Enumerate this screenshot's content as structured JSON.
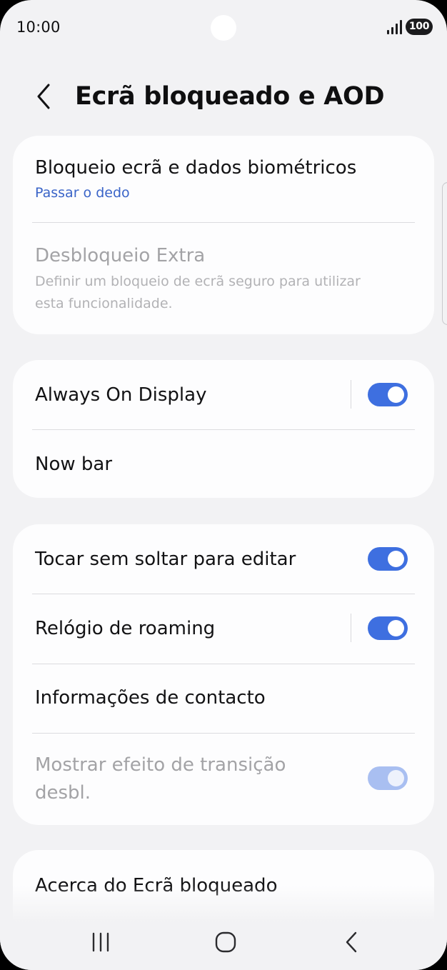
{
  "status_bar": {
    "time": "10:00",
    "battery": "100"
  },
  "header": {
    "title": "Ecrã bloqueado e AOD"
  },
  "cards": {
    "lock": {
      "items": [
        {
          "title": "Bloqueio ecrã e dados biométricos",
          "subtitle": "Passar o dedo"
        },
        {
          "title": "Desbloqueio Extra",
          "subtitle_line1": "Definir um bloqueio de ecrã seguro para utilizar",
          "subtitle_line2": "esta funcionalidade."
        }
      ]
    },
    "display": {
      "items": [
        {
          "title": "Always On Display",
          "toggle_on": true
        },
        {
          "title": "Now bar"
        }
      ]
    },
    "options": {
      "items": [
        {
          "title": "Tocar sem soltar para editar",
          "toggle_on": true
        },
        {
          "title": "Relógio de roaming",
          "toggle_on": true
        },
        {
          "title": "Informações de contacto"
        },
        {
          "title_line1": "Mostrar efeito de transição",
          "title_line2": "desbl.",
          "toggle_on": true,
          "disabled": true
        }
      ]
    },
    "about": {
      "title": "Acerca do Ecrã bloqueado"
    }
  },
  "colors": {
    "accent": "#3e6fe0",
    "link_text": "#3a64c8",
    "background": "#f2f2f4",
    "card": "#fdfdfe"
  },
  "icons": {
    "back": "chevron-left-icon",
    "signal": "signal-strength-icon",
    "recents": "recent-apps-icon",
    "home": "home-icon",
    "nav_back": "back-icon"
  }
}
